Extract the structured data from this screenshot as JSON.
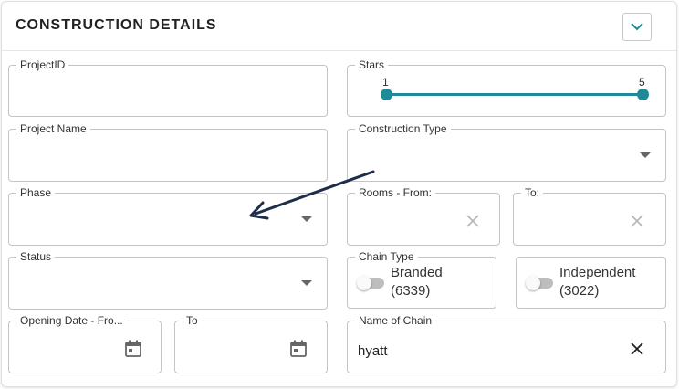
{
  "panel": {
    "title": "CONSTRUCTION DETAILS"
  },
  "fields": {
    "project_id": {
      "label": "ProjectID",
      "value": ""
    },
    "stars": {
      "label": "Stars",
      "min": "1",
      "max": "5"
    },
    "project_name": {
      "label": "Project Name",
      "value": ""
    },
    "construction_type": {
      "label": "Construction Type",
      "value": ""
    },
    "phase": {
      "label": "Phase",
      "value": ""
    },
    "rooms_from": {
      "label": "Rooms - From:",
      "value": ""
    },
    "rooms_to": {
      "label": "To:",
      "value": ""
    },
    "status": {
      "label": "Status",
      "value": ""
    },
    "chain_type": {
      "label": "Chain Type",
      "options": [
        {
          "label": "Branded",
          "count": "(6339)",
          "checked": false
        },
        {
          "label": "Independent",
          "count": "(3022)",
          "checked": false
        }
      ]
    },
    "opening_date_from": {
      "label": "Opening Date - Fro...",
      "value": ""
    },
    "opening_date_to": {
      "label": "To",
      "value": ""
    },
    "name_of_chain": {
      "label": "Name of Chain",
      "value": "hyatt"
    }
  },
  "icons": {
    "collapse": "chevron-down-icon",
    "dropdown": "arrow-drop-down-icon",
    "clear": "close-icon",
    "calendar": "calendar-icon"
  },
  "colors": {
    "accent": "#1e8a98",
    "annotation_arrow": "#1f2d4d"
  }
}
